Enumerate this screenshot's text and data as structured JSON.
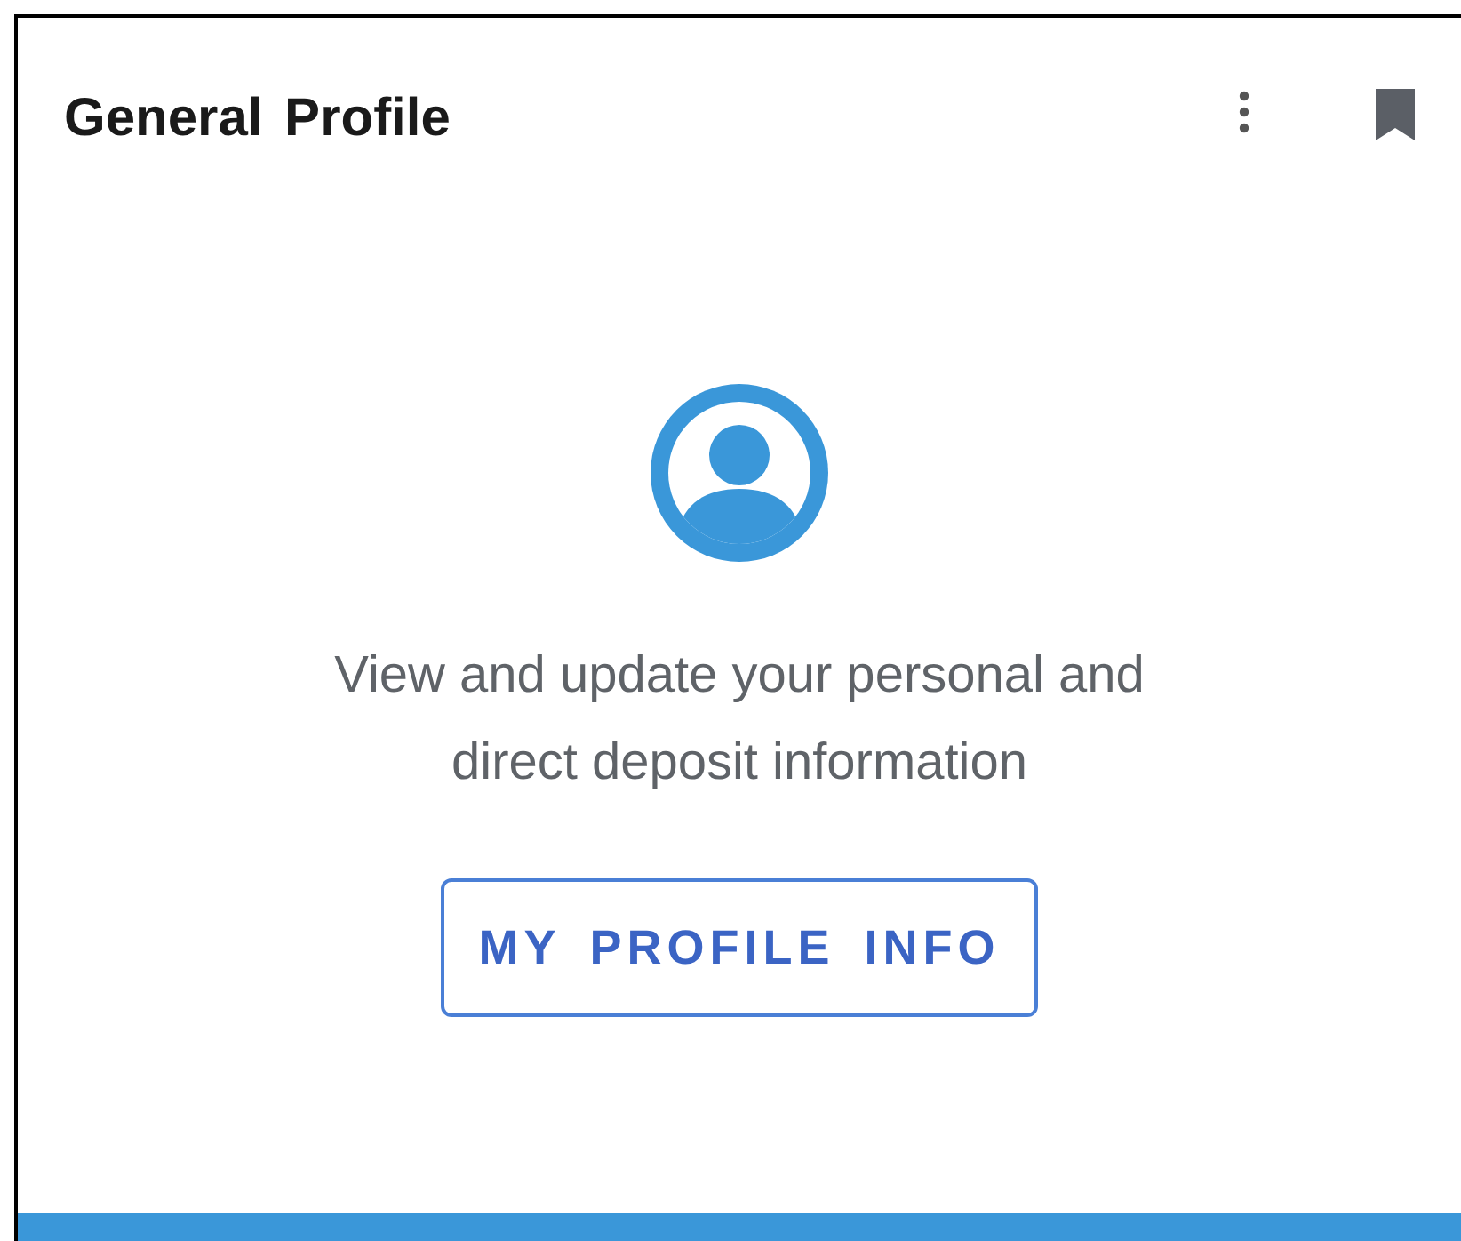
{
  "card": {
    "title": "General Profile",
    "description": "View and update your personal and direct deposit information",
    "button": "MY PROFILE INFO"
  }
}
